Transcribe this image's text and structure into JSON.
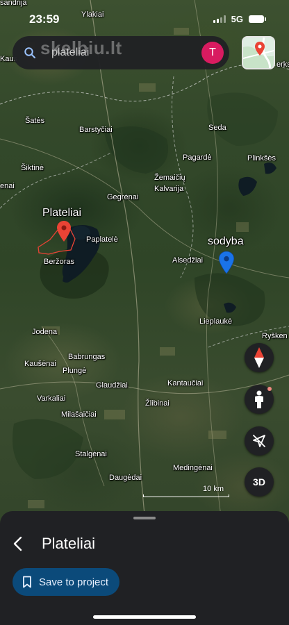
{
  "status": {
    "time": "23:59",
    "network": "5G"
  },
  "search": {
    "watermark": "skelbiu.lt",
    "query": "plateliai",
    "avatar_letter": "T"
  },
  "map": {
    "places": [
      {
        "id": "sandrija",
        "label": "sandrija"
      },
      {
        "id": "ylakiai",
        "label": "Ylakiai"
      },
      {
        "id": "kaus",
        "label": "Kaus"
      },
      {
        "id": "erks",
        "label": "erks"
      },
      {
        "id": "satės",
        "label": "Šatės"
      },
      {
        "id": "barstyciai",
        "label": "Barstyčiai"
      },
      {
        "id": "seda",
        "label": "Seda"
      },
      {
        "id": "siktine",
        "label": "Šiktinė"
      },
      {
        "id": "pagarde",
        "label": "Pagardė"
      },
      {
        "id": "plinkses",
        "label": "Plinkšės"
      },
      {
        "id": "enai",
        "label": "enai"
      },
      {
        "id": "zemaiciu",
        "label": "Žemaičių"
      },
      {
        "id": "kalvarija",
        "label": "Kalvarija"
      },
      {
        "id": "gegrenai",
        "label": "Gegrėnai"
      },
      {
        "id": "paplatele",
        "label": "Paplatelė"
      },
      {
        "id": "berzoras",
        "label": "Beržoras"
      },
      {
        "id": "alsedziai",
        "label": "Alsedžiai"
      },
      {
        "id": "lieplauke",
        "label": "Lieplaukė"
      },
      {
        "id": "ryskenai",
        "label": "Ryškėn"
      },
      {
        "id": "jodena",
        "label": "Jodena"
      },
      {
        "id": "babrungas",
        "label": "Babrungas"
      },
      {
        "id": "kausenai",
        "label": "Kaušėnai"
      },
      {
        "id": "plunge",
        "label": "Plungė"
      },
      {
        "id": "glaudziai",
        "label": "Glaudžiai"
      },
      {
        "id": "kantauciai",
        "label": "Kantaučiai"
      },
      {
        "id": "varkaliai",
        "label": "Varkaliai"
      },
      {
        "id": "zlibinai",
        "label": "Žlibinai"
      },
      {
        "id": "milasaiciai",
        "label": "Milašaičiai"
      },
      {
        "id": "stalgenai",
        "label": "Stalgėnai"
      },
      {
        "id": "medingenai",
        "label": "Medingėnai"
      },
      {
        "id": "daugedai",
        "label": "Daugėdai"
      }
    ],
    "pins": {
      "plateliai": "Plateliai",
      "sodyba": "sodyba"
    },
    "scale_label": "10 km",
    "colors": {
      "red_pin": "#ea4335",
      "blue_pin": "#1a73e8"
    }
  },
  "controls": {
    "compass": "compass-icon",
    "pegman": "pegman-icon",
    "location": "location-off-icon",
    "view_3d": "3D"
  },
  "sheet": {
    "title": "Plateliai",
    "save_button": "Save to project",
    "accent": "#0b4a7a"
  }
}
